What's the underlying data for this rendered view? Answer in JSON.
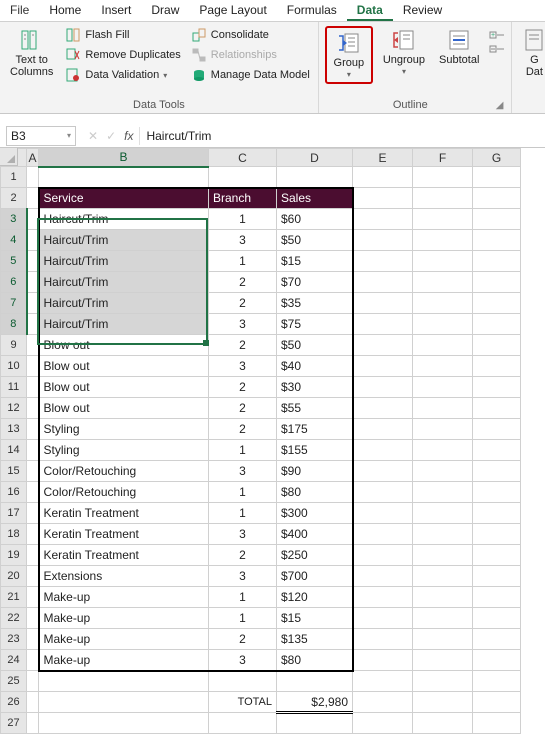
{
  "menu": {
    "file": "File",
    "home": "Home",
    "insert": "Insert",
    "draw": "Draw",
    "page_layout": "Page Layout",
    "formulas": "Formulas",
    "data": "Data",
    "review": "Review"
  },
  "ribbon": {
    "data_tools": {
      "label": "Data Tools",
      "text_to_columns": "Text to\nColumns",
      "flash_fill": "Flash Fill",
      "remove_duplicates": "Remove Duplicates",
      "data_validation": "Data Validation",
      "consolidate": "Consolidate",
      "relationships": "Relationships",
      "manage_data_model": "Manage Data Model"
    },
    "outline": {
      "label": "Outline",
      "group": "Group",
      "ungroup": "Ungroup",
      "subtotal": "Subtotal"
    },
    "partial": {
      "g": "G",
      "dat": "Dat"
    }
  },
  "namebox": "B3",
  "formula": "Haircut/Trim",
  "cols": [
    "A",
    "B",
    "C",
    "D",
    "E",
    "F",
    "G"
  ],
  "hdr": {
    "service": "Service",
    "branch": "Branch",
    "sales": "Sales"
  },
  "rows": [
    {
      "n": 3,
      "service": "Haircut/Trim",
      "branch": "1",
      "sales": "$60"
    },
    {
      "n": 4,
      "service": "Haircut/Trim",
      "branch": "3",
      "sales": "$50"
    },
    {
      "n": 5,
      "service": "Haircut/Trim",
      "branch": "1",
      "sales": "$15"
    },
    {
      "n": 6,
      "service": "Haircut/Trim",
      "branch": "2",
      "sales": "$70"
    },
    {
      "n": 7,
      "service": "Haircut/Trim",
      "branch": "2",
      "sales": "$35"
    },
    {
      "n": 8,
      "service": "Haircut/Trim",
      "branch": "3",
      "sales": "$75"
    },
    {
      "n": 9,
      "service": "Blow out",
      "branch": "2",
      "sales": "$50"
    },
    {
      "n": 10,
      "service": "Blow out",
      "branch": "3",
      "sales": "$40"
    },
    {
      "n": 11,
      "service": "Blow out",
      "branch": "2",
      "sales": "$30"
    },
    {
      "n": 12,
      "service": "Blow out",
      "branch": "2",
      "sales": "$55"
    },
    {
      "n": 13,
      "service": "Styling",
      "branch": "2",
      "sales": "$175"
    },
    {
      "n": 14,
      "service": "Styling",
      "branch": "1",
      "sales": "$155"
    },
    {
      "n": 15,
      "service": "Color/Retouching",
      "branch": "3",
      "sales": "$90"
    },
    {
      "n": 16,
      "service": "Color/Retouching",
      "branch": "1",
      "sales": "$80"
    },
    {
      "n": 17,
      "service": "Keratin Treatment",
      "branch": "1",
      "sales": "$300"
    },
    {
      "n": 18,
      "service": "Keratin Treatment",
      "branch": "3",
      "sales": "$400"
    },
    {
      "n": 19,
      "service": "Keratin Treatment",
      "branch": "2",
      "sales": "$250"
    },
    {
      "n": 20,
      "service": "Extensions",
      "branch": "3",
      "sales": "$700"
    },
    {
      "n": 21,
      "service": "Make-up",
      "branch": "1",
      "sales": "$120"
    },
    {
      "n": 22,
      "service": "Make-up",
      "branch": "1",
      "sales": "$15"
    },
    {
      "n": 23,
      "service": "Make-up",
      "branch": "2",
      "sales": "$135"
    },
    {
      "n": 24,
      "service": "Make-up",
      "branch": "3",
      "sales": "$80"
    }
  ],
  "total": {
    "label": "TOTAL",
    "value": "$2,980"
  }
}
